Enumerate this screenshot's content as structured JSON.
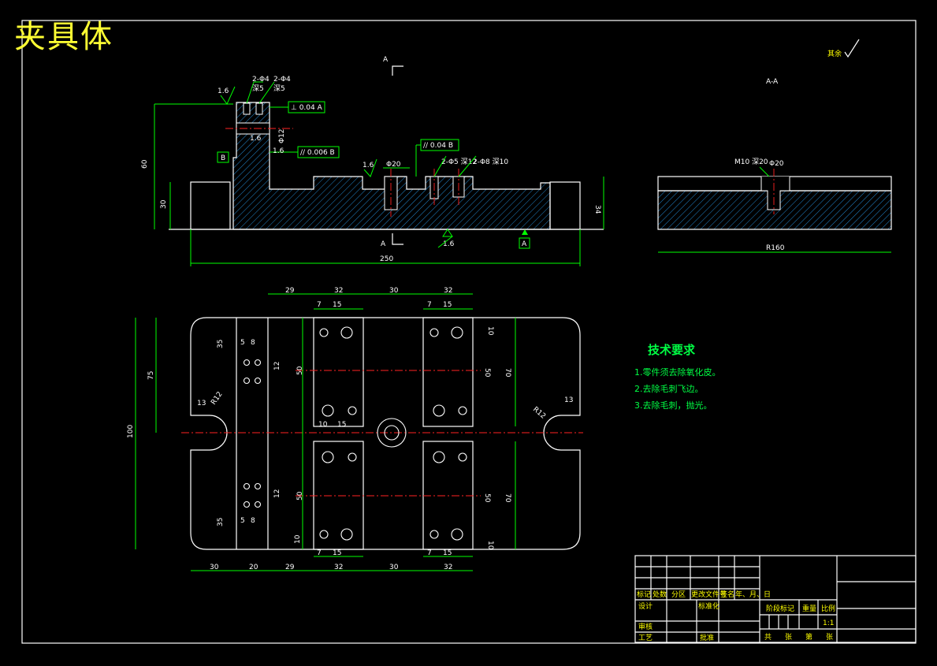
{
  "drawing": {
    "title": "夹具体",
    "surface_note": "其余",
    "section_labels": {
      "a_top": "A",
      "a_bottom": "A",
      "aa": "A-A"
    },
    "tech_requirements": {
      "title": "技术要求",
      "items": [
        "1.零件须去除氧化皮。",
        "2.去除毛刺飞边。",
        "3.去除毛刺，抛光。"
      ]
    },
    "front_view": {
      "top_holes": [
        "2-Φ4",
        "2-Φ4",
        "深5",
        "深5"
      ],
      "tol_frames": [
        "⊥ 0.04 A",
        "// 0.006 B",
        "// 0.04 B"
      ],
      "roughness": [
        "1.6",
        "1.6",
        "1.6",
        "1.6",
        "1.6"
      ],
      "datum_b": "B",
      "datum_a": "A",
      "dims": {
        "overall_length": "250",
        "height_total": "60",
        "height_base": "30",
        "right_height": "34",
        "bore": "Φ12"
      },
      "holes": [
        "Φ20",
        "2-Φ5 深12",
        "2-Φ8 深10"
      ]
    },
    "section_view": {
      "hole": "M10 深20",
      "dia": "Φ20",
      "width": "R160"
    },
    "plan_view": {
      "top_dims": [
        "29",
        "32",
        "30",
        "32"
      ],
      "sub_dims_top": [
        "7",
        "15",
        "7",
        "15"
      ],
      "bottom_dims": [
        "30",
        "20",
        "29",
        "32",
        "30",
        "32"
      ],
      "sub_dims_bottom": [
        "7",
        "15",
        "7",
        "15"
      ],
      "left_dims": [
        "100",
        "75"
      ],
      "inner_dims": [
        "35",
        "5",
        "8",
        "50",
        "12",
        "35",
        "5",
        "8",
        "12",
        "50"
      ],
      "right_dims": [
        "10",
        "50",
        "70",
        "10",
        "70",
        "50",
        "10"
      ],
      "slot_dims": [
        "13",
        "R12",
        "13",
        "R12",
        "15",
        "10"
      ]
    },
    "title_block": {
      "row_labels": [
        "标记",
        "处数",
        "分区",
        "更改文件号",
        "签名",
        "年、月、日"
      ],
      "design": "设计",
      "standard": "标准化",
      "review": "审核",
      "process": "工艺",
      "approve": "批准",
      "stage_mark": "阶段标记",
      "weight": "重量",
      "scale": "比例",
      "scale_value": "1:1",
      "sheets": [
        "共",
        "张",
        "第",
        "张"
      ]
    }
  },
  "colors": {
    "background": "#000000",
    "title": "#ffff33",
    "dimension": "#00ff00",
    "outline": "#ffffff",
    "center": "#ff2222",
    "hatch": "#00aaff"
  }
}
